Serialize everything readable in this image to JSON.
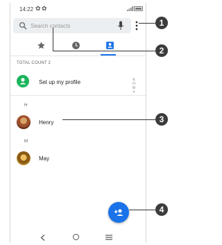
{
  "status_bar": {
    "time": "14:22",
    "icons": [
      "gear-icon",
      "gear-icon",
      "signal-icon",
      "battery-icon"
    ]
  },
  "search": {
    "placeholder": "Search contacts"
  },
  "tabs": [
    {
      "id": "favorites",
      "icon": "star-icon"
    },
    {
      "id": "recent",
      "icon": "clock-icon"
    },
    {
      "id": "contacts",
      "icon": "contact-card-icon",
      "selected": true
    }
  ],
  "total_count_label": "TOTAL COUNT 2",
  "profile": {
    "label": "Set up my profile"
  },
  "index_letters": [
    "&",
    "H",
    "M",
    "#"
  ],
  "sections": [
    {
      "header": "H",
      "contact": "Henry"
    },
    {
      "header": "M",
      "contact": "May"
    }
  ],
  "fab": {
    "icon": "add-person-icon"
  },
  "nav": {
    "back": "back-icon",
    "home": "home-icon",
    "recents": "recents-icon"
  },
  "callouts": [
    "1",
    "2",
    "3",
    "4"
  ],
  "colors": {
    "accent": "#1a73e8",
    "profile_avatar": "#1bb55c",
    "callout": "#3c3c3c"
  }
}
